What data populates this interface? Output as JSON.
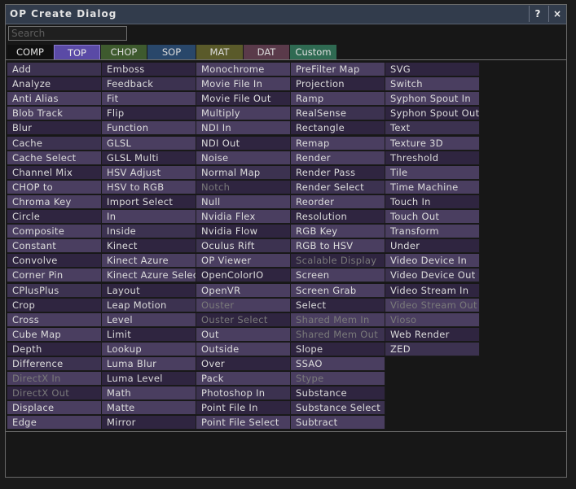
{
  "window": {
    "title": "OP Create Dialog",
    "help_label": "?",
    "close_label": "×"
  },
  "search": {
    "placeholder": "Search",
    "value": ""
  },
  "tabs": [
    {
      "label": "COMP",
      "bg": "#101010",
      "fg": "#e0e0e0"
    },
    {
      "label": "TOP",
      "bg": "#5a4aa6",
      "fg": "#e8e8e8",
      "selected": true
    },
    {
      "label": "CHOP",
      "bg": "#3e5a2e",
      "fg": "#dcdcdc"
    },
    {
      "label": "SOP",
      "bg": "#29476a",
      "fg": "#dcdcdc"
    },
    {
      "label": "MAT",
      "bg": "#5a5a2a",
      "fg": "#dcdcdc"
    },
    {
      "label": "DAT",
      "bg": "#5a3a4a",
      "fg": "#dcdcdc"
    },
    {
      "label": "Custom",
      "bg": "#2f6a52",
      "fg": "#e0e0e0"
    }
  ],
  "columns": [
    [
      {
        "label": "Add"
      },
      {
        "label": "Analyze"
      },
      {
        "label": "Anti Alias"
      },
      {
        "label": "Blob Track"
      },
      {
        "label": "Blur"
      },
      {
        "label": "Cache"
      },
      {
        "label": "Cache Select"
      },
      {
        "label": "Channel Mix"
      },
      {
        "label": "CHOP to"
      },
      {
        "label": "Chroma Key"
      },
      {
        "label": "Circle"
      },
      {
        "label": "Composite"
      },
      {
        "label": "Constant"
      },
      {
        "label": "Convolve"
      },
      {
        "label": "Corner Pin"
      },
      {
        "label": "CPlusPlus"
      },
      {
        "label": "Crop"
      },
      {
        "label": "Cross"
      },
      {
        "label": "Cube Map"
      },
      {
        "label": "Depth"
      },
      {
        "label": "Difference"
      },
      {
        "label": "DirectX In",
        "disabled": true
      },
      {
        "label": "DirectX Out",
        "disabled": true
      },
      {
        "label": "Displace"
      },
      {
        "label": "Edge"
      }
    ],
    [
      {
        "label": "Emboss"
      },
      {
        "label": "Feedback"
      },
      {
        "label": "Fit"
      },
      {
        "label": "Flip"
      },
      {
        "label": "Function"
      },
      {
        "label": "GLSL"
      },
      {
        "label": "GLSL Multi"
      },
      {
        "label": "HSV Adjust"
      },
      {
        "label": "HSV to RGB"
      },
      {
        "label": "Import Select"
      },
      {
        "label": "In"
      },
      {
        "label": "Inside"
      },
      {
        "label": "Kinect"
      },
      {
        "label": "Kinect Azure"
      },
      {
        "label": "Kinect Azure Select"
      },
      {
        "label": "Layout"
      },
      {
        "label": "Leap Motion"
      },
      {
        "label": "Level"
      },
      {
        "label": "Limit"
      },
      {
        "label": "Lookup"
      },
      {
        "label": "Luma Blur"
      },
      {
        "label": "Luma Level"
      },
      {
        "label": "Math"
      },
      {
        "label": "Matte"
      },
      {
        "label": "Mirror"
      }
    ],
    [
      {
        "label": "Monochrome"
      },
      {
        "label": "Movie File In"
      },
      {
        "label": "Movie File Out"
      },
      {
        "label": "Multiply"
      },
      {
        "label": "NDI In"
      },
      {
        "label": "NDI Out"
      },
      {
        "label": "Noise"
      },
      {
        "label": "Normal Map"
      },
      {
        "label": "Notch",
        "disabled": true
      },
      {
        "label": "Null"
      },
      {
        "label": "Nvidia Flex"
      },
      {
        "label": "Nvidia Flow"
      },
      {
        "label": "Oculus Rift"
      },
      {
        "label": "OP Viewer"
      },
      {
        "label": "OpenColorIO"
      },
      {
        "label": "OpenVR"
      },
      {
        "label": "Ouster",
        "disabled": true
      },
      {
        "label": "Ouster Select",
        "disabled": true
      },
      {
        "label": "Out"
      },
      {
        "label": "Outside"
      },
      {
        "label": "Over"
      },
      {
        "label": "Pack"
      },
      {
        "label": "Photoshop In"
      },
      {
        "label": "Point File In"
      },
      {
        "label": "Point File Select"
      }
    ],
    [
      {
        "label": "PreFilter Map"
      },
      {
        "label": "Projection"
      },
      {
        "label": "Ramp"
      },
      {
        "label": "RealSense"
      },
      {
        "label": "Rectangle"
      },
      {
        "label": "Remap"
      },
      {
        "label": "Render"
      },
      {
        "label": "Render Pass"
      },
      {
        "label": "Render Select"
      },
      {
        "label": "Reorder"
      },
      {
        "label": "Resolution"
      },
      {
        "label": "RGB Key"
      },
      {
        "label": "RGB to HSV"
      },
      {
        "label": "Scalable Display",
        "disabled": true
      },
      {
        "label": "Screen"
      },
      {
        "label": "Screen Grab"
      },
      {
        "label": "Select"
      },
      {
        "label": "Shared Mem In",
        "disabled": true
      },
      {
        "label": "Shared Mem Out",
        "disabled": true
      },
      {
        "label": "Slope"
      },
      {
        "label": "SSAO"
      },
      {
        "label": "Stype",
        "disabled": true
      },
      {
        "label": "Substance"
      },
      {
        "label": "Substance Select"
      },
      {
        "label": "Subtract"
      }
    ],
    [
      {
        "label": "SVG"
      },
      {
        "label": "Switch"
      },
      {
        "label": "Syphon Spout In"
      },
      {
        "label": "Syphon Spout Out"
      },
      {
        "label": "Text"
      },
      {
        "label": "Texture 3D"
      },
      {
        "label": "Threshold"
      },
      {
        "label": "Tile"
      },
      {
        "label": "Time Machine"
      },
      {
        "label": "Touch In"
      },
      {
        "label": "Touch Out"
      },
      {
        "label": "Transform"
      },
      {
        "label": "Under"
      },
      {
        "label": "Video Device In"
      },
      {
        "label": "Video Device Out"
      },
      {
        "label": "Video Stream In"
      },
      {
        "label": "Video Stream Out",
        "disabled": true
      },
      {
        "label": "Vioso",
        "disabled": true
      },
      {
        "label": "Web Render"
      },
      {
        "label": "ZED"
      }
    ]
  ]
}
